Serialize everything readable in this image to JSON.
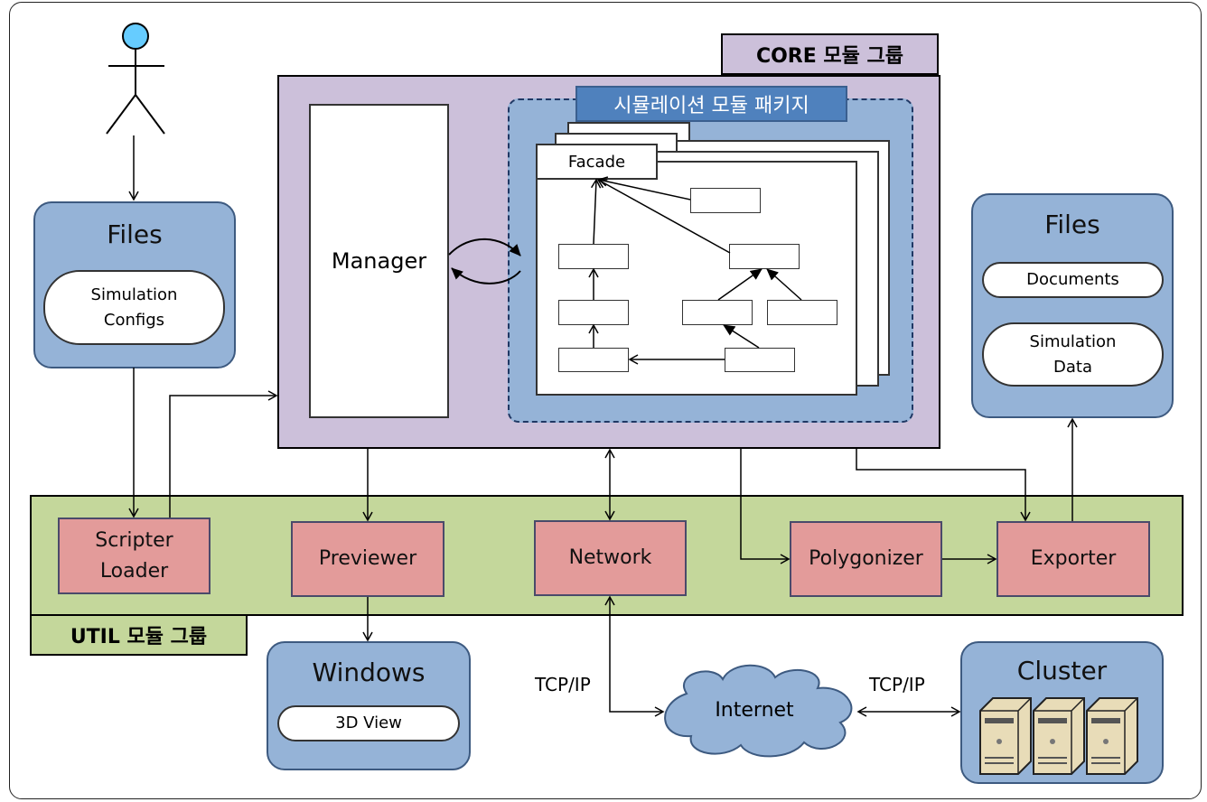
{
  "core_label": "CORE 모듈 그룹",
  "util_label": "UTIL 모듈 그룹",
  "package_title": "시뮬레이션 모듈 패키지",
  "facade": "Facade",
  "manager": "Manager",
  "files_left": {
    "title": "Files",
    "item": "Simulation\nConfigs"
  },
  "files_right": {
    "title": "Files",
    "items": [
      "Documents",
      "Simulation\nData"
    ]
  },
  "util_modules": [
    "Scripter\nLoader",
    "Previewer",
    "Network",
    "Polygonizer",
    "Exporter"
  ],
  "windows": {
    "title": "Windows",
    "item": "3D View"
  },
  "internet": "Internet",
  "cluster": "Cluster",
  "protocol_left": "TCP/IP",
  "protocol_right": "TCP/IP",
  "colors": {
    "core": "#ccc0da",
    "util": "#c4d79b",
    "module": "#e39b9a",
    "container": "#95b3d7",
    "package_title": "#4f81bd"
  }
}
